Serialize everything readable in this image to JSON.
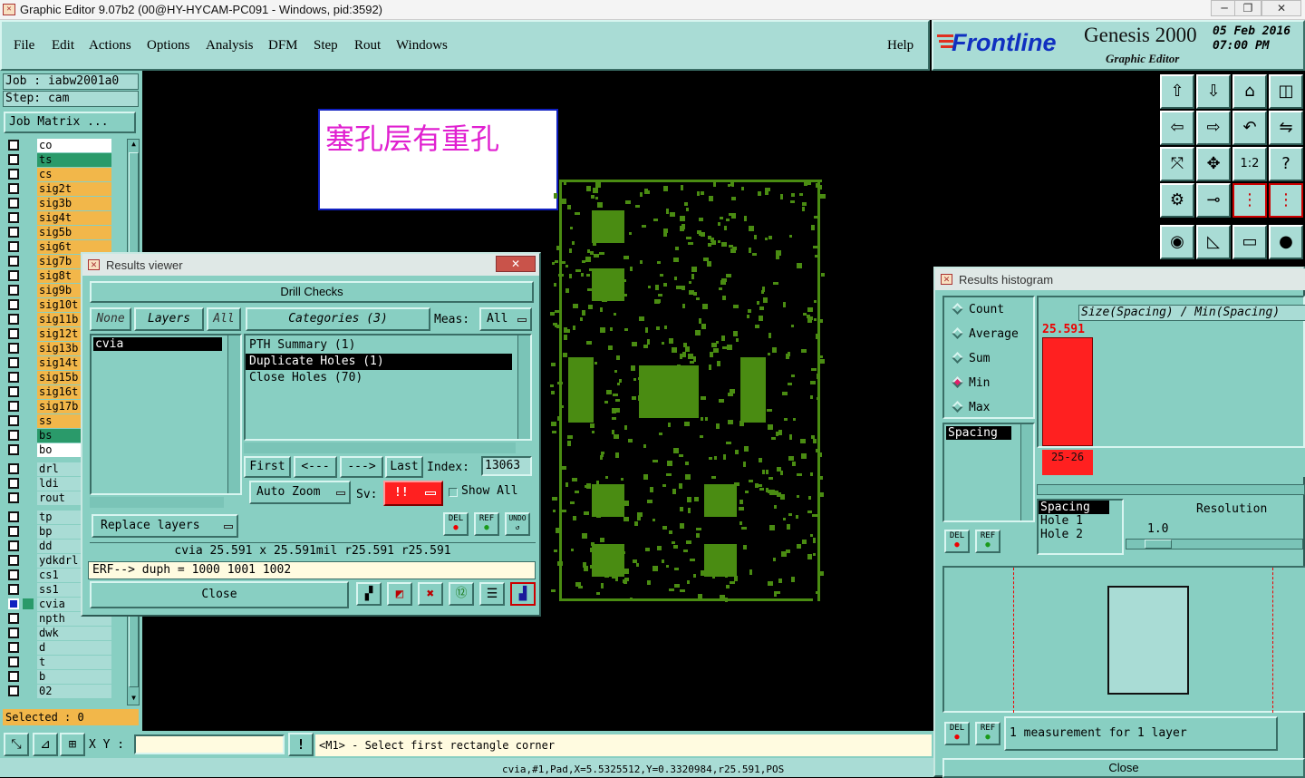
{
  "window": {
    "title": "Graphic Editor 9.07b2 (00@HY-HYCAM-PC091 - Windows, pid:3592)",
    "min": "─",
    "max": "❐",
    "close": "✕"
  },
  "menu": {
    "items": [
      "File",
      "Edit",
      "Actions",
      "Options",
      "Analysis",
      "DFM",
      "Step",
      "Rout",
      "Windows"
    ],
    "help": "Help"
  },
  "brand": {
    "logo": "Frontline",
    "product": "Genesis 2000",
    "subtitle": "Graphic Editor",
    "date": "05 Feb 2016",
    "time": "07:00 PM"
  },
  "job": {
    "job": "Job : iabw2001a0",
    "step": "Step: cam",
    "matrix": "Job Matrix ..."
  },
  "layers": [
    {
      "name": "co",
      "style": "wh"
    },
    {
      "name": "ts",
      "style": "gr"
    },
    {
      "name": "cs",
      "style": "sig"
    },
    {
      "name": "sig2t",
      "style": "sig"
    },
    {
      "name": "sig3b",
      "style": "sig"
    },
    {
      "name": "sig4t",
      "style": "sig"
    },
    {
      "name": "sig5b",
      "style": "sig"
    },
    {
      "name": "sig6t",
      "style": "sig"
    },
    {
      "name": "sig7b",
      "style": "sig"
    },
    {
      "name": "sig8t",
      "style": "sig"
    },
    {
      "name": "sig9b",
      "style": "sig"
    },
    {
      "name": "sig10t",
      "style": "sig"
    },
    {
      "name": "sig11b",
      "style": "sig"
    },
    {
      "name": "sig12t",
      "style": "sig"
    },
    {
      "name": "sig13b",
      "style": "sig"
    },
    {
      "name": "sig14t",
      "style": "sig"
    },
    {
      "name": "sig15b",
      "style": "sig"
    },
    {
      "name": "sig16t",
      "style": "sig"
    },
    {
      "name": "sig17b",
      "style": "sig"
    },
    {
      "name": "ss",
      "style": "sig"
    },
    {
      "name": "bs",
      "style": "gr"
    },
    {
      "name": "bo",
      "style": "wh"
    }
  ],
  "layers2": [
    {
      "name": "drl"
    },
    {
      "name": "ldi"
    },
    {
      "name": "rout"
    }
  ],
  "layers3": [
    "tp",
    "bp",
    "dd",
    "ydkdrl",
    "cs1",
    "ss1",
    "cvia",
    "npth",
    "dwk",
    "d",
    "t",
    "b",
    "02"
  ],
  "selected": "Selected : 0",
  "note": "塞孔层有重孔",
  "viewer": {
    "title": "Results viewer",
    "header": "Drill Checks",
    "none": "None",
    "layers": "Layers",
    "all": "All",
    "categories": "Categories (3)",
    "meas": "Meas:",
    "meas_val": "All",
    "layer_list": [
      "cvia"
    ],
    "cat_list": [
      "PTH Summary (1)",
      "Duplicate Holes (1)",
      "Close Holes (70)"
    ],
    "first": "First",
    "prev": "<---",
    "next": "--->",
    "last": "Last",
    "index": "Index:",
    "index_val": "13063",
    "auto_zoom": "Auto Zoom",
    "sv": "Sv:",
    "sv_val": "!!",
    "show_all": "Show All",
    "replace": "Replace layers",
    "del": "DEL",
    "ref": "REF",
    "undo": "UNDO",
    "info": "cvia 25.591 x 25.591mil  r25.591  r25.591",
    "erf": "ERF--> duph = 1000 1001 1002",
    "close": "Close"
  },
  "histogram": {
    "title": "Results histogram",
    "options": [
      "Count",
      "Average",
      "Sum",
      "Min",
      "Max"
    ],
    "selected": "Min",
    "header": "Size(Spacing) / Min(Spacing)",
    "bar_value": "25.591",
    "bar_label": "25-26",
    "list": [
      "Spacing"
    ],
    "list2": [
      "Spacing",
      "Hole 1",
      "Hole 2"
    ],
    "resolution": "Resolution",
    "res_val": "1.0",
    "measure": "1 measurement for 1 layer",
    "close": "Close",
    "del": "DEL",
    "ref": "REF",
    "bar_fraction": 1.0
  },
  "status": {
    "xy": "X Y :",
    "xy_val": "",
    "msg": "<M1> - Select first rectangle corner",
    "bottom": "cvia,#1,Pad,X=5.5325512,Y=0.3320984,r25.591,POS"
  },
  "colors": {
    "accent": "#88cfc2",
    "pcb": "#4a8c12",
    "highlight": "#ff2020",
    "signal": "#f2b74a"
  }
}
